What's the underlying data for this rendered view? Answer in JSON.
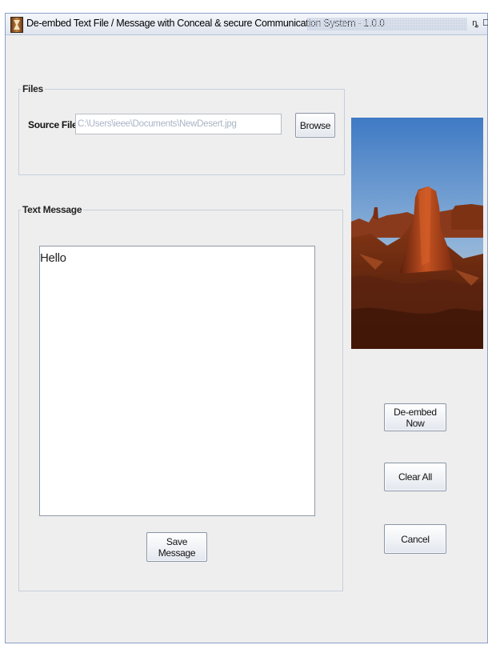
{
  "window": {
    "title": "De-embed  Text  File / Message with Conceal & secure Communication System - 1.0.0",
    "restore_glyph": "ȵ",
    "close_glyph": "☐"
  },
  "files": {
    "legend": "Files",
    "source_label": "Source File",
    "source_path": "C:\\Users\\ieee\\Documents\\NewDesert.jpg",
    "browse_label": "Browse"
  },
  "message": {
    "legend": "Text Message",
    "text": "Hello",
    "save_label": "Save Message"
  },
  "actions": {
    "deembed_label": "De-embed Now",
    "clear_label": "Clear All",
    "cancel_label": "Cancel"
  },
  "preview": {
    "icon": "desert-photo"
  },
  "colors": {
    "window_bg": "#eeeeee",
    "title_bar": "#dfe5ef",
    "border": "#8aa0c8"
  }
}
